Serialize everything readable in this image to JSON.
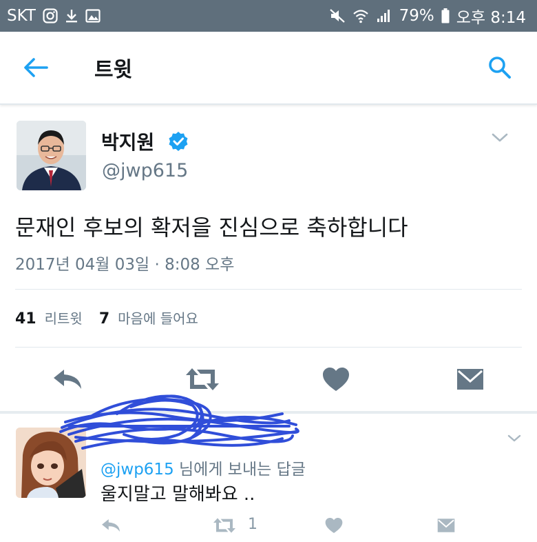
{
  "status_bar": {
    "carrier": "SKT",
    "battery": "79%",
    "time": "오후 8:14",
    "icons": [
      "instagram-icon",
      "download-icon",
      "image-icon",
      "mute-icon",
      "wifi-icon",
      "signal-icon",
      "battery-icon"
    ]
  },
  "header": {
    "title": "트윗",
    "back_icon": "back-arrow-icon",
    "search_icon": "search-icon"
  },
  "tweet": {
    "display_name": "박지원",
    "handle": "@jwp615",
    "verified": true,
    "text": "문재인 후보의 확저을 진심으로 축하합니다",
    "timestamp": "2017년 04월 03일 · 8:08 오후",
    "retweets": {
      "count": "41",
      "label": "리트윗"
    },
    "likes": {
      "count": "7",
      "label": "마음에 들어요"
    },
    "actions": [
      "reply-icon",
      "retweet-icon",
      "like-icon",
      "message-icon"
    ]
  },
  "reply": {
    "mention": "@jwp615",
    "context_suffix": " 님에게 보내는 답글",
    "text": "울지말고 말해봐요 ..",
    "retweet_count": "1",
    "actions": [
      "reply-icon",
      "retweet-icon",
      "like-icon",
      "message-icon"
    ]
  },
  "colors": {
    "status_bar": "#5f6f7c",
    "accent": "#1da1f2",
    "primary_text": "#14171a",
    "secondary_text": "#657786",
    "icon_gray": "#657786",
    "scribble": "#1f3fd6"
  }
}
